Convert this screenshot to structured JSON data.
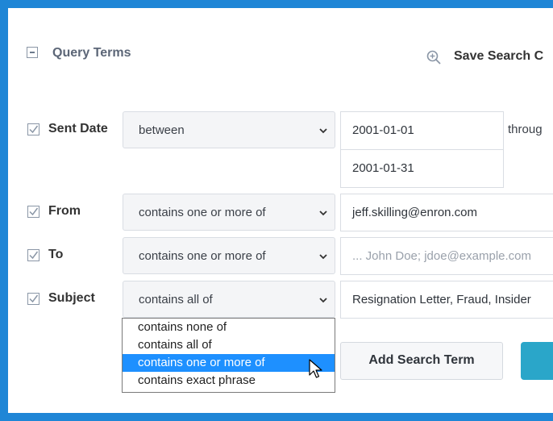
{
  "header": {
    "title": "Query Terms",
    "save_label": "Save Search C"
  },
  "rows": [
    {
      "label": "Sent Date",
      "operator": "between",
      "value": "2001-01-01",
      "value2": "2001-01-31",
      "suffix": "throug"
    },
    {
      "label": "From",
      "operator": "contains one or more of",
      "value": "jeff.skilling@enron.com"
    },
    {
      "label": "To",
      "operator": "contains one or more of",
      "placeholder": "... John Doe; jdoe@example.com"
    },
    {
      "label": "Subject",
      "operator": "contains all of",
      "value": "Resignation Letter, Fraud, Insider"
    }
  ],
  "dropdown": {
    "options": [
      "contains none of",
      "contains all of",
      "contains one or more of",
      "contains exact phrase"
    ],
    "highlighted_index": 2
  },
  "buttons": {
    "add_label": "Add Search Term"
  },
  "colors": {
    "frame": "#1f86d6",
    "highlight": "#1e90ff",
    "teal_button": "#2aa6c9"
  },
  "icons": [
    "collapse-icon",
    "zoom-in-icon",
    "checkbox-checked-icon",
    "chevron-down-icon",
    "mouse-pointer-icon"
  ]
}
